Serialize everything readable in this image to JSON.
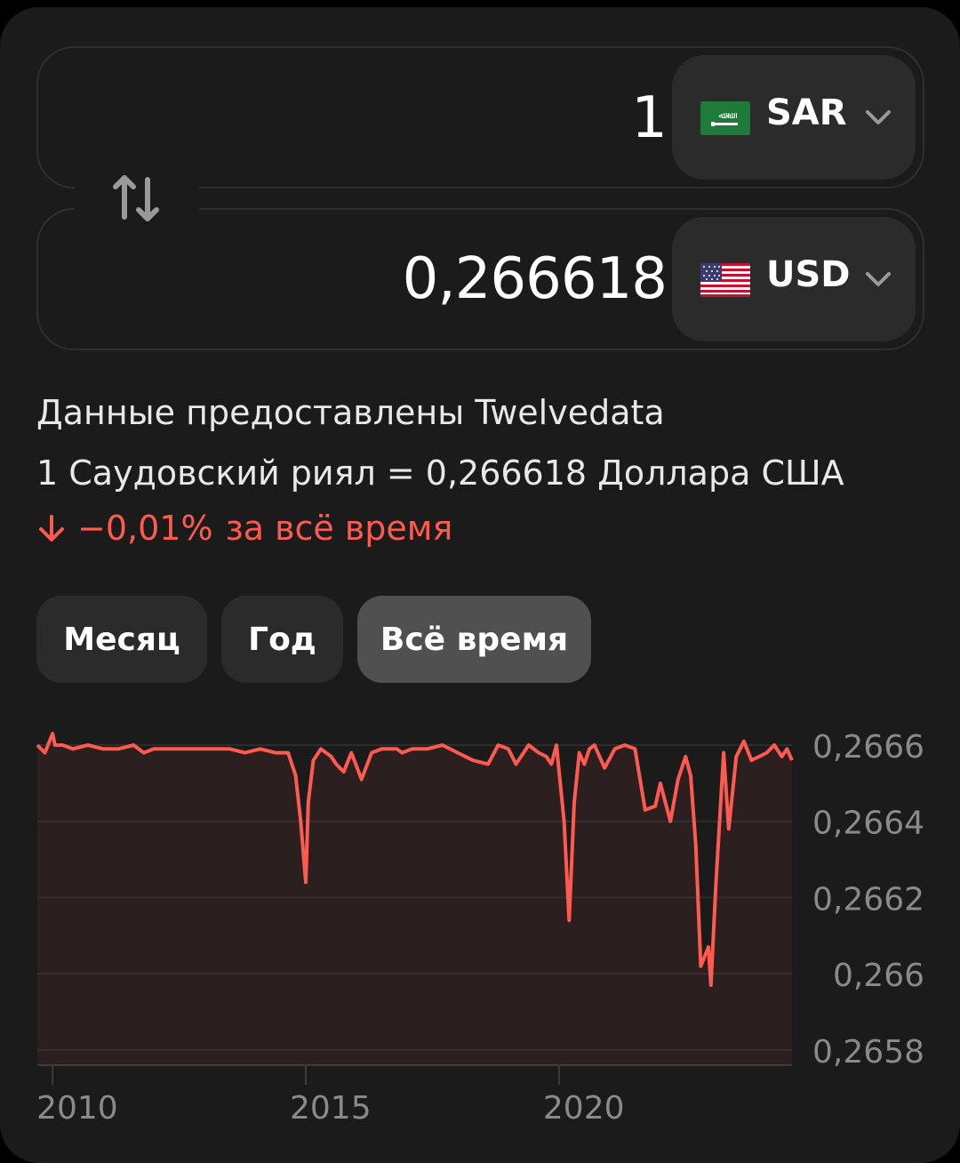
{
  "converter": {
    "from": {
      "amount": "1",
      "currency": "SAR",
      "flag": "saudi-arabia-flag"
    },
    "to": {
      "amount": "0,266618",
      "currency": "USD",
      "flag": "usa-flag"
    }
  },
  "info": {
    "provider": "Данные предоставлены Twelvedata",
    "rate": "1 Саудовский риял = 0,266618 Доллара США",
    "change_pct": "−0,01%",
    "change_period": "за всё время"
  },
  "tabs": [
    {
      "label": "Месяц",
      "active": false
    },
    {
      "label": "Год",
      "active": false
    },
    {
      "label": "Всё время",
      "active": true
    }
  ],
  "colors": {
    "background": "#1b1b1b",
    "line": "#ff5a4f",
    "negative": "#ff5a4f",
    "button": "#2b2b2b",
    "button_active": "#505050"
  },
  "chart_data": {
    "type": "line",
    "title": "",
    "xlabel": "",
    "ylabel": "",
    "x_ticks": [
      "2010",
      "2015",
      "2020"
    ],
    "y_ticks": [
      "0,2666",
      "0,2664",
      "0,2662",
      "0,266",
      "0,2658"
    ],
    "ylim": [
      0.26576,
      0.26667
    ],
    "xlim": [
      2009.7,
      2024.6
    ],
    "grid": "horizontal",
    "series": [
      {
        "x": [
          2009.7,
          2009.85,
          2010.0,
          2010.05,
          2010.2,
          2010.4,
          2010.7,
          2011.0,
          2011.3,
          2011.6,
          2011.8,
          2012.0,
          2012.3,
          2012.6,
          2012.9,
          2013.2,
          2013.5,
          2013.8,
          2014.1,
          2014.4,
          2014.65,
          2014.8,
          2014.9,
          2015.0,
          2015.05,
          2015.15,
          2015.3,
          2015.5,
          2015.6,
          2015.75,
          2015.9,
          2016.1,
          2016.3,
          2016.5,
          2016.7,
          2016.8,
          2016.9,
          2017.1,
          2017.4,
          2017.7,
          2018.0,
          2018.3,
          2018.6,
          2018.8,
          2019.0,
          2019.15,
          2019.4,
          2019.6,
          2019.75,
          2019.85,
          2019.95,
          2020.1,
          2020.2,
          2020.3,
          2020.4,
          2020.5,
          2020.6,
          2020.7,
          2020.9,
          2021.1,
          2021.3,
          2021.5,
          2021.7,
          2021.9,
          2022.0,
          2022.2,
          2022.35,
          2022.5,
          2022.6,
          2022.7,
          2022.8,
          2022.95,
          2023.0,
          2023.1,
          2023.25,
          2023.35,
          2023.5,
          2023.65,
          2023.8,
          2023.95,
          2024.1,
          2024.25,
          2024.4,
          2024.5,
          2024.6
        ],
        "y": [
          0.2666,
          0.26658,
          0.26663,
          0.2666,
          0.2666,
          0.26659,
          0.2666,
          0.26659,
          0.26659,
          0.2666,
          0.26658,
          0.26659,
          0.26659,
          0.26659,
          0.26659,
          0.26659,
          0.26659,
          0.26658,
          0.26659,
          0.26658,
          0.26658,
          0.26652,
          0.2664,
          0.26624,
          0.26645,
          0.26656,
          0.26659,
          0.26657,
          0.26655,
          0.26653,
          0.26658,
          0.26651,
          0.26658,
          0.26659,
          0.26659,
          0.26659,
          0.26658,
          0.26659,
          0.26659,
          0.2666,
          0.26658,
          0.26656,
          0.26655,
          0.2666,
          0.26659,
          0.26655,
          0.2666,
          0.26658,
          0.26657,
          0.26655,
          0.2666,
          0.2664,
          0.26614,
          0.26645,
          0.26658,
          0.26655,
          0.26659,
          0.2666,
          0.26654,
          0.26659,
          0.2666,
          0.26659,
          0.26643,
          0.26644,
          0.2665,
          0.2664,
          0.26651,
          0.26657,
          0.26652,
          0.26634,
          0.26602,
          0.26607,
          0.26597,
          0.26624,
          0.26658,
          0.26638,
          0.26657,
          0.26661,
          0.26656,
          0.26657,
          0.26658,
          0.2666,
          0.26657,
          0.26659,
          0.26656
        ]
      }
    ]
  }
}
